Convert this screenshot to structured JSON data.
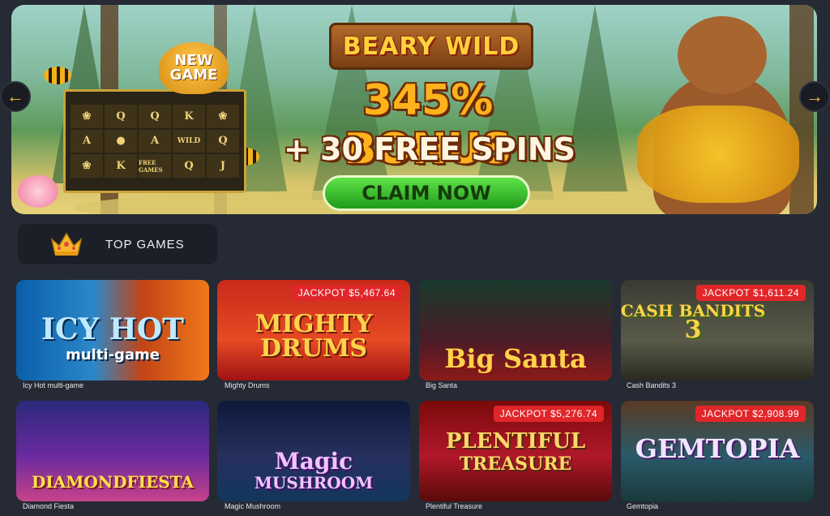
{
  "banner": {
    "logo": "BEARY WILD",
    "line1": "345% BONUS",
    "line2": "+ 30 FREE SPINS",
    "cta": "CLAIM NOW",
    "badge_line1": "NEW",
    "badge_line2": "GAME",
    "mini_wild": "WILD",
    "mini_free": "FREE GAMES",
    "prev_icon": "arrow-left-icon",
    "next_icon": "arrow-right-icon"
  },
  "section": {
    "title": "TOP GAMES",
    "icon": "crown-icon"
  },
  "games": [
    {
      "name": "Icy Hot multi-game",
      "art_line1": "ICY HOT",
      "art_line2": "multi-game",
      "jackpot": ""
    },
    {
      "name": "Mighty Drums",
      "art_line1": "MIGHTY",
      "art_line2": "DRUMS",
      "jackpot": "JACKPOT $5,467.64"
    },
    {
      "name": "Big Santa",
      "art_line1": "Big Santa",
      "art_line2": "",
      "jackpot": ""
    },
    {
      "name": "Cash Bandits 3",
      "art_line1": "CASH BANDITS",
      "art_line2": "3",
      "jackpot": "JACKPOT $1,611.24"
    },
    {
      "name": "Diamond Fiesta",
      "art_line1": "DIAMONDFIESTA",
      "art_line2": "",
      "jackpot": ""
    },
    {
      "name": "Magic Mushroom",
      "art_line1": "Magic",
      "art_line2": "MUSHROOM",
      "jackpot": ""
    },
    {
      "name": "Plentiful Treasure",
      "art_line1": "PLENTIFUL",
      "art_line2": "TREASURE",
      "jackpot": "JACKPOT $5,276.74"
    },
    {
      "name": "Gemtopia",
      "art_line1": "GEMTOPIA",
      "art_line2": "",
      "jackpot": "JACKPOT $2,908.99"
    }
  ],
  "colors": {
    "background": "#262a35",
    "jackpot_badge": "#e1262a",
    "cta_green": "#2fb528",
    "accent_gold": "#ffb21c"
  }
}
